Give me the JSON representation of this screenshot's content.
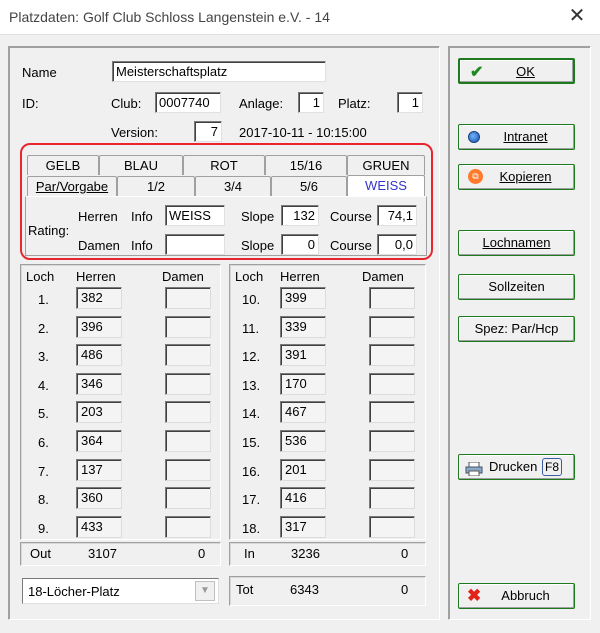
{
  "window": {
    "title": "Platzdaten: Golf Club Schloss Langenstein e.V. - 14"
  },
  "header": {
    "name_label": "Name",
    "name_value": "Meisterschaftsplatz",
    "id_label": "ID:",
    "club_label": "Club:",
    "club_value": "0007740",
    "anlage_label": "Anlage:",
    "anlage_value": "1",
    "platz_label": "Platz:",
    "platz_value": "1",
    "version_label": "Version:",
    "version_value": "7",
    "version_date": "2017-10-11 - 10:15:00"
  },
  "tabs_row1": [
    "GELB",
    "BLAU",
    "ROT",
    "15/16",
    "GRUEN"
  ],
  "tabs_row2": [
    "Par/Vorgabe",
    "1/2",
    "3/4",
    "5/6",
    "WEISS"
  ],
  "rating": {
    "label": "Rating:",
    "herren_label": "Herren",
    "damen_label": "Damen",
    "info_label": "Info",
    "herren_info": "WEISS",
    "damen_info": "",
    "slope_label": "Slope",
    "course_label": "Course",
    "herren_slope": "132",
    "herren_course": "74,1",
    "damen_slope": "0",
    "damen_course": "0,0"
  },
  "holes": {
    "col_loch": "Loch",
    "col_herren": "Herren",
    "col_damen": "Damen",
    "front": [
      {
        "loch": "1.",
        "herren": "382",
        "damen": ""
      },
      {
        "loch": "2.",
        "herren": "396",
        "damen": ""
      },
      {
        "loch": "3.",
        "herren": "486",
        "damen": ""
      },
      {
        "loch": "4.",
        "herren": "346",
        "damen": ""
      },
      {
        "loch": "5.",
        "herren": "203",
        "damen": ""
      },
      {
        "loch": "6.",
        "herren": "364",
        "damen": ""
      },
      {
        "loch": "7.",
        "herren": "137",
        "damen": ""
      },
      {
        "loch": "8.",
        "herren": "360",
        "damen": ""
      },
      {
        "loch": "9.",
        "herren": "433",
        "damen": ""
      }
    ],
    "back": [
      {
        "loch": "10.",
        "herren": "399",
        "damen": ""
      },
      {
        "loch": "11.",
        "herren": "339",
        "damen": ""
      },
      {
        "loch": "12.",
        "herren": "391",
        "damen": ""
      },
      {
        "loch": "13.",
        "herren": "170",
        "damen": ""
      },
      {
        "loch": "14.",
        "herren": "467",
        "damen": ""
      },
      {
        "loch": "15.",
        "herren": "536",
        "damen": ""
      },
      {
        "loch": "16.",
        "herren": "201",
        "damen": ""
      },
      {
        "loch": "17.",
        "herren": "416",
        "damen": ""
      },
      {
        "loch": "18.",
        "herren": "317",
        "damen": ""
      }
    ],
    "out_label": "Out",
    "out_herren": "3107",
    "out_damen": "0",
    "in_label": "In",
    "in_herren": "3236",
    "in_damen": "0",
    "tot_label": "Tot",
    "tot_herren": "6343",
    "tot_damen": "0"
  },
  "course_type": {
    "selected": "18-Löcher-Platz"
  },
  "buttons": {
    "ok": "OK",
    "intranet": "Intranet",
    "kopieren": "Kopieren",
    "lochnamen": "Lochnamen",
    "sollzeiten": "Sollzeiten",
    "spez": "Spez: Par/Hcp",
    "drucken": "Drucken",
    "drucken_key": "F8",
    "abbruch": "Abbruch"
  },
  "colors": {
    "accent_red": "#e8262e",
    "active_tab": "#3333cc",
    "button_border": "#1e7a1e"
  }
}
